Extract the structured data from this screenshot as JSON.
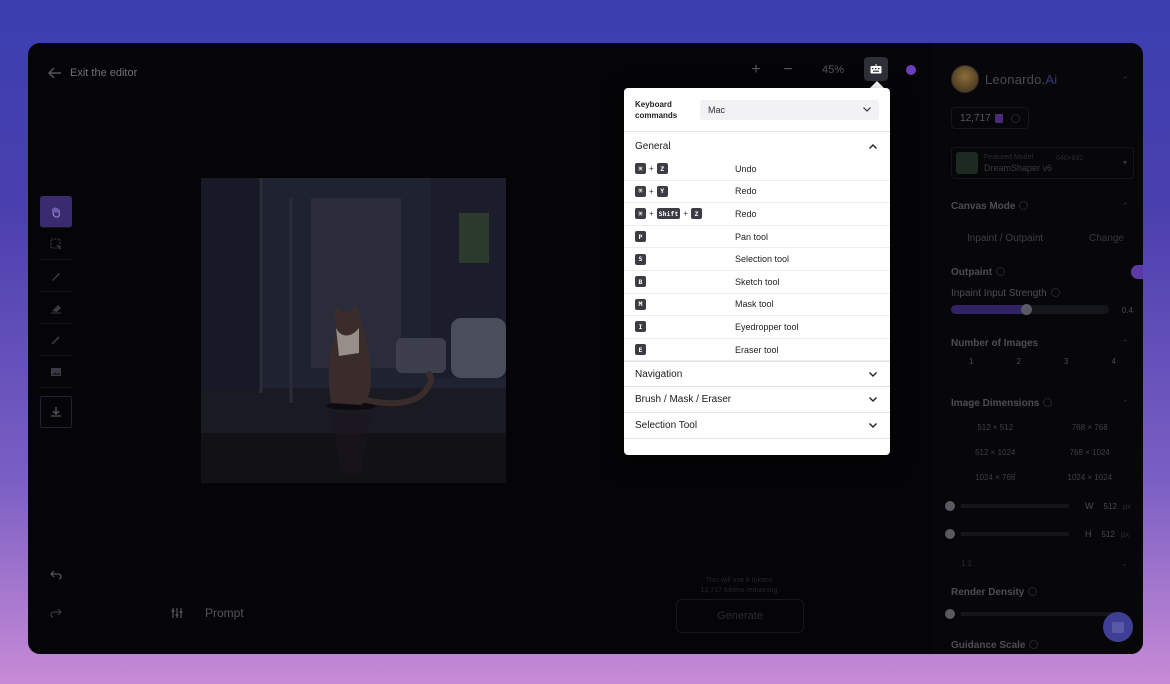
{
  "header": {
    "exit_label": "Exit the editor",
    "zoom": "45%",
    "plus": "+",
    "minus": "−"
  },
  "left_tools": [
    "pan-tool",
    "selection-tool",
    "sketch-tool",
    "mask-tool",
    "pencil-tool",
    "image-tool",
    "download-tool"
  ],
  "prompt": {
    "placeholder": "Prompt",
    "token_info_line1": "This will use 8 tokens",
    "token_info_line2": "12,717 tokens remaining",
    "generate_label": "Generate"
  },
  "popup": {
    "title_line1": "Keyboard",
    "title_line2": "commands",
    "os_select": "Mac",
    "general": {
      "label": "General",
      "rows": [
        {
          "keys": [
            "⌘",
            "Z"
          ],
          "desc": "Undo"
        },
        {
          "keys": [
            "⌘",
            "Y"
          ],
          "desc": "Redo"
        },
        {
          "keys": [
            "⌘",
            "Shift",
            "Z"
          ],
          "desc": "Redo"
        },
        {
          "keys": [
            "P"
          ],
          "desc": "Pan tool"
        },
        {
          "keys": [
            "S"
          ],
          "desc": "Selection tool"
        },
        {
          "keys": [
            "B"
          ],
          "desc": "Sketch tool"
        },
        {
          "keys": [
            "M"
          ],
          "desc": "Mask tool"
        },
        {
          "keys": [
            "I"
          ],
          "desc": "Eyedropper tool"
        },
        {
          "keys": [
            "E"
          ],
          "desc": "Eraser tool"
        }
      ]
    },
    "groups": [
      "Navigation",
      "Brush / Mask / Eraser",
      "Selection Tool"
    ]
  },
  "right_panel": {
    "brand": "Leonardo.",
    "brand_suffix": "Ai",
    "tokens": "12,717",
    "model_label": "Featured Model",
    "model_dims": "640×832",
    "model_name": "DreamShaper v6",
    "canvas_mode_title": "Canvas Mode",
    "canvas_mode_value": "Inpaint / Outpaint",
    "canvas_mode_change": "Change",
    "outpaint_label": "Outpaint",
    "inpaint_strength_label": "Inpaint Input Strength",
    "inpaint_strength_value": "0.4",
    "num_images_label": "Number of Images",
    "num_images": [
      "1",
      "2",
      "3",
      "4"
    ],
    "image_dimensions_label": "Image Dimensions",
    "dimensions": [
      "512 × 512",
      "768 × 768",
      "512 × 1024",
      "768 × 1024",
      "1024 × 768",
      "1024 × 1024"
    ],
    "width_label": "W",
    "width_value": "512",
    "height_label": "H",
    "height_value": "512",
    "unit": "px",
    "aspect_ratio": "1:1",
    "render_density_label": "Render Density",
    "guidance_scale_label": "Guidance Scale"
  },
  "colors": {
    "accent": "#5b3aa6",
    "background_top": "#3b3fb0",
    "background_bottom": "#c88bd6"
  }
}
